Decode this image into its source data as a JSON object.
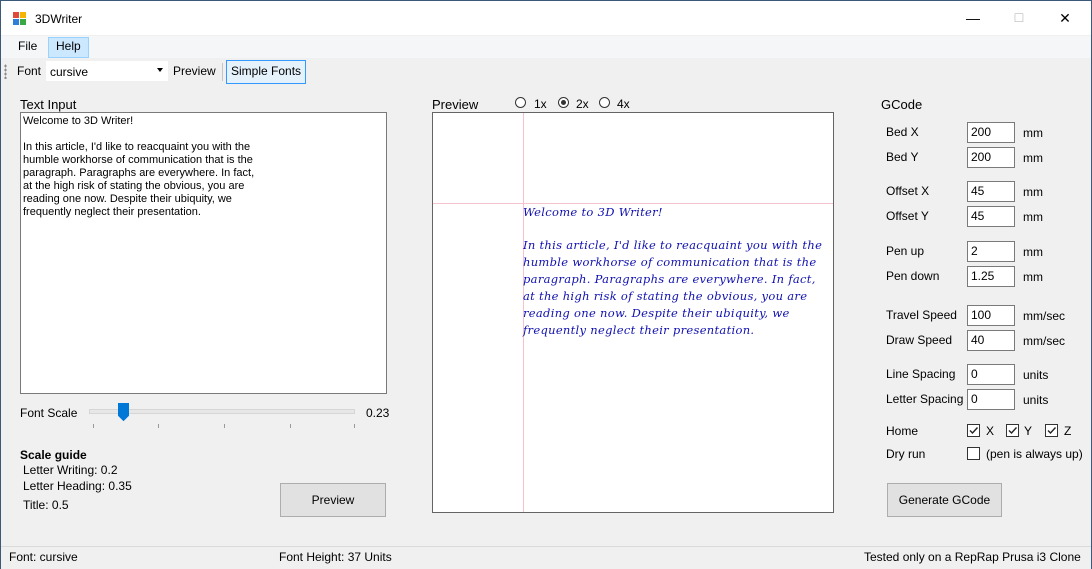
{
  "window": {
    "title": "3DWriter",
    "min_glyph": "—",
    "max_glyph": "☐",
    "close_glyph": "✕"
  },
  "menu": {
    "file": "File",
    "help": "Help"
  },
  "toolbar": {
    "font_label": "Font",
    "font_value": "cursive",
    "preview_label": "Preview",
    "simple_fonts_label": "Simple Fonts"
  },
  "text_input": {
    "heading": "Text Input",
    "lines": [
      "Welcome to 3D Writer!",
      "",
      "In this article, I'd like to reacquaint you with the",
      "humble workhorse of communication that is the",
      "paragraph. Paragraphs are everywhere. In fact,",
      "at the high risk of stating the obvious, you are",
      "reading one now. Despite their ubiquity, we",
      "frequently neglect their presentation."
    ]
  },
  "font_scale": {
    "label": "Font Scale",
    "value_text": "0.23",
    "fraction": 0.13
  },
  "scale_guide": {
    "heading": "Scale guide",
    "items": [
      "Letter Writing: 0.2",
      "Letter Heading: 0.35",
      "Title: 0.5"
    ]
  },
  "preview_button": "Preview",
  "preview": {
    "heading": "Preview",
    "zoom_options": [
      "1x",
      "2x",
      "4x"
    ],
    "zoom_selected": "2x",
    "lines": [
      "Welcome to 3D Writer!",
      "",
      "In this article, I'd like to reacquaint you with the",
      "humble workhorse of communication that is the",
      "paragraph. Paragraphs are everywhere. In fact,",
      "at the high risk of stating the obvious, you are",
      "reading one now. Despite their ubiquity, we",
      "frequently neglect their presentation."
    ]
  },
  "gcode": {
    "heading": "GCode",
    "fields": {
      "bed_x": {
        "label": "Bed X",
        "value": "200",
        "unit": "mm"
      },
      "bed_y": {
        "label": "Bed Y",
        "value": "200",
        "unit": "mm"
      },
      "offset_x": {
        "label": "Offset X",
        "value": "45",
        "unit": "mm"
      },
      "offset_y": {
        "label": "Offset Y",
        "value": "45",
        "unit": "mm"
      },
      "pen_up": {
        "label": "Pen up",
        "value": "2",
        "unit": "mm"
      },
      "pen_down": {
        "label": "Pen down",
        "value": "1.25",
        "unit": "mm"
      },
      "travel_speed": {
        "label": "Travel Speed",
        "value": "100",
        "unit": "mm/sec"
      },
      "draw_speed": {
        "label": "Draw Speed",
        "value": "40",
        "unit": "mm/sec"
      },
      "line_spacing": {
        "label": "Line Spacing",
        "value": "0",
        "unit": "units"
      },
      "letter_spacing": {
        "label": "Letter Spacing",
        "value": "0",
        "unit": "units"
      }
    },
    "home_label": "Home",
    "home_x": "X",
    "home_y": "Y",
    "home_z": "Z",
    "dry_run_label": "Dry run",
    "dry_run_note": "(pen is always up)",
    "generate_button": "Generate GCode"
  },
  "status": {
    "font": "Font: cursive",
    "height": "Font Height: 37 Units",
    "note": "Tested only on a RepRap Prusa i3 Clone"
  }
}
